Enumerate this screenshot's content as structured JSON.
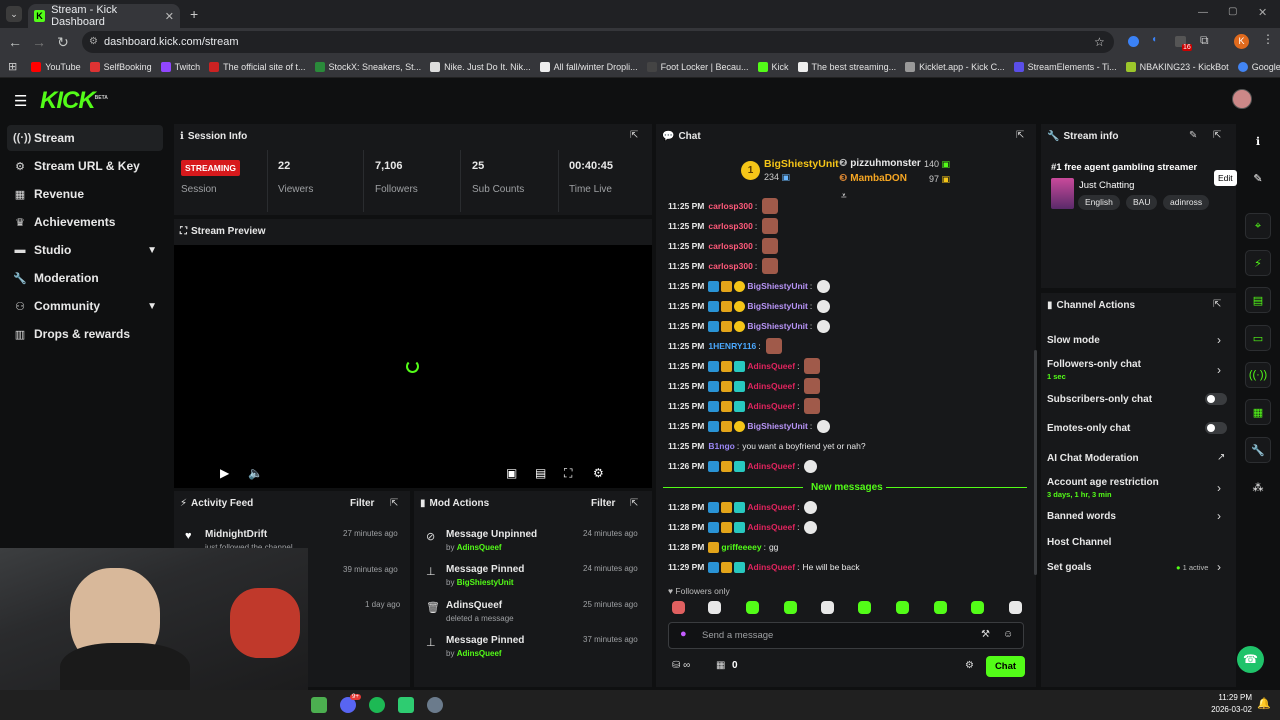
{
  "browser": {
    "tab_title": "Stream - Kick Dashboard",
    "url": "dashboard.kick.com/stream",
    "bookmarks": [
      "YouTube",
      "SelfBooking",
      "Twitch",
      "The official site of t...",
      "StockX: Sneakers, St...",
      "Nike. Just Do It. Nik...",
      "All fall/winter Dropli...",
      "Foot Locker | Becau...",
      "Kick",
      "The best streaming...",
      "Kicklet.app - Kick C...",
      "StreamElements - Ti...",
      "NBAKING23 - KickBot",
      "Google"
    ],
    "ext_badge": "16"
  },
  "brand": {
    "logo": "KICK",
    "beta": "BETA",
    "accent": "#53fc18"
  },
  "sidebar": {
    "items": [
      {
        "icon": "stream-icon",
        "label": "Stream"
      },
      {
        "icon": "key-icon",
        "label": "Stream URL & Key"
      },
      {
        "icon": "revenue-icon",
        "label": "Revenue"
      },
      {
        "icon": "trophy-icon",
        "label": "Achievements"
      },
      {
        "icon": "studio-icon",
        "label": "Studio"
      },
      {
        "icon": "wrench-icon",
        "label": "Moderation"
      },
      {
        "icon": "community-icon",
        "label": "Community"
      },
      {
        "icon": "gift-icon",
        "label": "Drops & rewards"
      }
    ]
  },
  "session": {
    "title": "Session Info",
    "status": "STREAMING",
    "status_label": "Session",
    "stats": [
      {
        "value": "22",
        "label": "Viewers"
      },
      {
        "value": "7,106",
        "label": "Followers"
      },
      {
        "value": "25",
        "label": "Sub Counts"
      },
      {
        "value": "00:40:45",
        "label": "Time Live"
      }
    ]
  },
  "preview": {
    "title": "Stream Preview"
  },
  "activity": {
    "title": "Activity Feed",
    "filter": "Filter",
    "items": [
      {
        "name": "MidnightDrift",
        "sub": "just followed the channel",
        "time": "27 minutes ago"
      },
      {
        "name": "",
        "sub": "",
        "time": "39 minutes ago"
      },
      {
        "name": "",
        "sub": "",
        "time": "1 day ago"
      }
    ]
  },
  "mod_actions": {
    "title": "Mod Actions",
    "filter": "Filter",
    "items": [
      {
        "icon": "unpin-icon",
        "title": "Message Unpinned",
        "prefix": "by",
        "by": "AdinsQueef",
        "time": "24 minutes ago"
      },
      {
        "icon": "pin-icon",
        "title": "Message Pinned",
        "prefix": "by",
        "by": "BigShiestyUnit",
        "time": "24 minutes ago"
      },
      {
        "icon": "trash-icon",
        "title": "AdinsQueef",
        "prefix": "deleted a message",
        "by": "",
        "time": "25 minutes ago"
      },
      {
        "icon": "pin-icon",
        "title": "Message Pinned",
        "prefix": "by",
        "by": "AdinsQueef",
        "time": "37 minutes ago"
      }
    ]
  },
  "chat": {
    "title": "Chat",
    "leaders": {
      "rank": "1",
      "top_name": "BigShiestyUnit",
      "top_value": "234",
      "second_name": "pizzuhmonster",
      "second_value": "140",
      "third_name": "MambaDON",
      "third_value": "97"
    },
    "messages": [
      {
        "time": "11:25 PM",
        "user": "carlosp300",
        "color": "#ff5a7a",
        "badges": [],
        "text": ""
      },
      {
        "time": "11:25 PM",
        "user": "carlosp300",
        "color": "#ff5a7a",
        "badges": [],
        "text": ""
      },
      {
        "time": "11:25 PM",
        "user": "carlosp300",
        "color": "#ff5a7a",
        "badges": [],
        "text": ""
      },
      {
        "time": "11:25 PM",
        "user": "carlosp300",
        "color": "#ff5a7a",
        "badges": [],
        "text": ""
      },
      {
        "time": "11:25 PM",
        "user": "BigShiestyUnit",
        "color": "#b794f6",
        "badges": [
          "blue",
          "gold",
          "coin"
        ],
        "text": ""
      },
      {
        "time": "11:25 PM",
        "user": "BigShiestyUnit",
        "color": "#b794f6",
        "badges": [
          "blue",
          "gold",
          "coin"
        ],
        "text": ""
      },
      {
        "time": "11:25 PM",
        "user": "BigShiestyUnit",
        "color": "#b794f6",
        "badges": [
          "blue",
          "gold",
          "coin"
        ],
        "text": ""
      },
      {
        "time": "11:25 PM",
        "user": "1HENRY116",
        "color": "#4aa8ff",
        "badges": [],
        "text": ""
      },
      {
        "time": "11:25 PM",
        "user": "AdinsQueef",
        "color": "#e0245e",
        "badges": [
          "blue",
          "gold",
          "teal"
        ],
        "text": ""
      },
      {
        "time": "11:25 PM",
        "user": "AdinsQueef",
        "color": "#e0245e",
        "badges": [
          "blue",
          "gold",
          "teal"
        ],
        "text": ""
      },
      {
        "time": "11:25 PM",
        "user": "AdinsQueef",
        "color": "#e0245e",
        "badges": [
          "blue",
          "gold",
          "teal"
        ],
        "text": ""
      },
      {
        "time": "11:25 PM",
        "user": "BigShiestyUnit",
        "color": "#b794f6",
        "badges": [
          "blue",
          "gold",
          "coin"
        ],
        "text": ""
      },
      {
        "time": "11:25 PM",
        "user": "B1ngo",
        "color": "#9b87f5",
        "badges": [],
        "text": "you want a boyfriend yet or nah?"
      },
      {
        "time": "11:26 PM",
        "user": "AdinsQueef",
        "color": "#e0245e",
        "badges": [
          "blue",
          "gold",
          "teal"
        ],
        "text": ""
      },
      {
        "time": "11:28 PM",
        "user": "AdinsQueef",
        "color": "#e0245e",
        "badges": [
          "blue",
          "gold",
          "teal"
        ],
        "text": ""
      },
      {
        "time": "11:28 PM",
        "user": "AdinsQueef",
        "color": "#e0245e",
        "badges": [
          "blue",
          "gold",
          "teal"
        ],
        "text": ""
      },
      {
        "time": "11:28 PM",
        "user": "griffeeeey",
        "color": "#53fc18",
        "badges": [
          "gold"
        ],
        "text": "gg"
      },
      {
        "time": "11:29 PM",
        "user": "AdinsQueef",
        "color": "#e0245e",
        "badges": [
          "blue",
          "gold",
          "teal"
        ],
        "text": "He will be back"
      }
    ],
    "new_messages": "New messages",
    "followers_only": "Followers only",
    "placeholder": "Send a message",
    "count": "0",
    "send": "Chat"
  },
  "stream_info": {
    "title": "Stream info",
    "stream_title": "#1 free agent gambling streamer",
    "category": "Just Chatting",
    "tags": [
      "English",
      "BAU",
      "adinross"
    ],
    "edit_tooltip": "Edit"
  },
  "channel_actions": {
    "title": "Channel Actions",
    "slow_mode": "Slow mode",
    "followers_only": "Followers-only chat",
    "followers_only_sub": "1 sec",
    "subscribers_only": "Subscribers-only chat",
    "emotes_only": "Emotes-only chat",
    "ai_moderation": "AI Chat Moderation",
    "age_restriction": "Account age restriction",
    "age_restriction_sub": "3 days, 1 hr, 3 min",
    "banned_words": "Banned words",
    "host_channel": "Host Channel",
    "set_goals": "Set goals",
    "set_goals_status": "1 active"
  },
  "taskbar": {
    "time": "11:29 PM",
    "date": "2026-03-02",
    "discord_badge": "9+"
  }
}
